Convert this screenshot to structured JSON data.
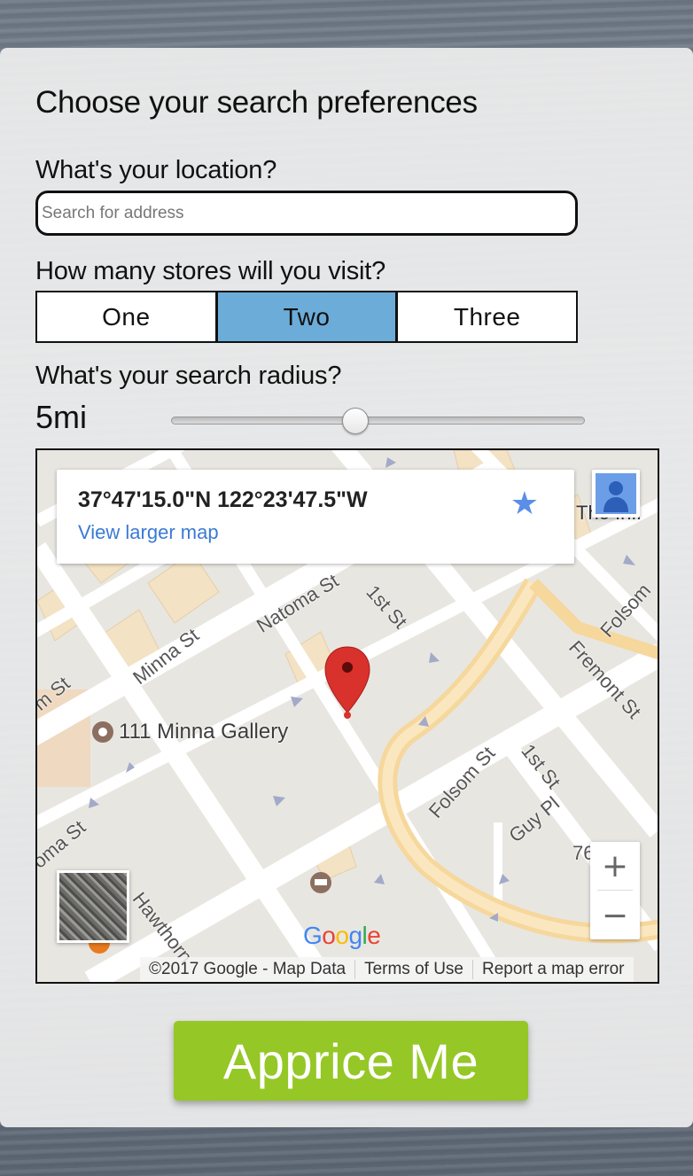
{
  "title": "Choose your search preferences",
  "location": {
    "label": "What's your location?",
    "placeholder": "Search for address",
    "value": ""
  },
  "stores": {
    "label": "How many stores will you visit?",
    "options": [
      "One",
      "Two",
      "Three"
    ],
    "selected": "Two"
  },
  "radius": {
    "label": "What's your search radius?",
    "value_text": "5mi",
    "slider_fraction": 0.45
  },
  "map": {
    "coords": "37°47'15.0\"N 122°23'47.5\"W",
    "larger_map_link": "View larger map",
    "streets": [
      "Natoma St",
      "1st St",
      "Minna St",
      "Fremont St",
      "Folsom St",
      "Guy Pl",
      "Hawthorn",
      "Folsom",
      "oma St",
      "m St"
    ],
    "poi_gallery": "111 Minna Gallery",
    "cut_labels": [
      "The Infi",
      "76"
    ],
    "logo": "Google",
    "copyright": "©2017 Google - Map Data",
    "terms": "Terms of Use",
    "report": "Report a map error",
    "zoom_in": "+",
    "zoom_out": "−"
  },
  "cta": {
    "label": "Apprice Me"
  },
  "colors": {
    "selected_segment": "#6cacd9",
    "cta_bg": "#95c726",
    "link": "#3a7bd5",
    "pin": "#d9312b"
  }
}
